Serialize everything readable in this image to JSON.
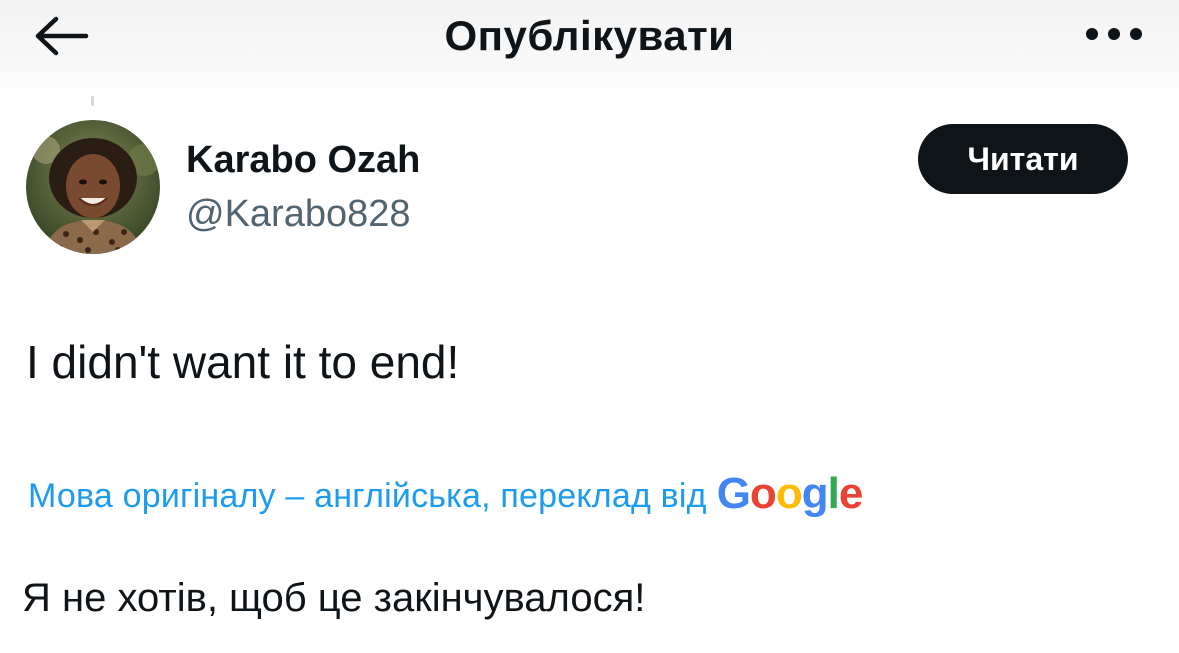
{
  "header": {
    "title": "Опублікувати",
    "back_icon": "arrow-left-icon",
    "more_icon": "ellipsis-icon"
  },
  "author": {
    "name": "Karabo Ozah",
    "handle": "@Karabo828",
    "follow_label": "Читати"
  },
  "tweet": {
    "text": "I didn't want it to end!",
    "translation_note": "Мова оригіналу – англійська, переклад від",
    "translation_provider": {
      "letters": [
        "G",
        "o",
        "o",
        "g",
        "l",
        "e"
      ],
      "colors": [
        "#4285F4",
        "#EA4335",
        "#FBBC05",
        "#4285F4",
        "#34A853",
        "#EA4335"
      ]
    },
    "translated_text": "Я не хотів, щоб це закінчувалося!"
  },
  "colors": {
    "link_blue": "#1d9bf0",
    "text_primary": "#0f1419",
    "text_secondary": "#536471",
    "button_dark": "#0f1419"
  }
}
